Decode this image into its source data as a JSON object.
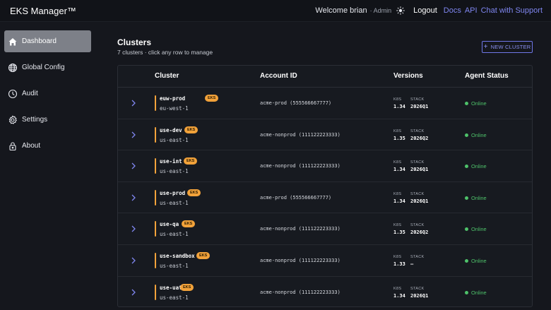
{
  "header": {
    "brand": "EKS Manager™",
    "welcome": "Welcome brian",
    "role": "· Admin",
    "logout": "Logout",
    "links": [
      "Docs",
      "API",
      "Chat with Support"
    ]
  },
  "sidebar": {
    "items": [
      {
        "label": "Dashboard",
        "icon": "home-icon",
        "active": true
      },
      {
        "label": "Global Config",
        "icon": "globe-icon",
        "active": false
      },
      {
        "label": "Audit",
        "icon": "clock-icon",
        "active": false
      },
      {
        "label": "Settings",
        "icon": "gear-icon",
        "active": false
      },
      {
        "label": "About",
        "icon": "lock-icon",
        "active": false
      }
    ]
  },
  "main": {
    "title": "Clusters",
    "subtitle": "7 clusters · click any row to manage",
    "new_button": "NEW CLUSTER"
  },
  "table": {
    "columns": [
      "Cluster",
      "Account ID",
      "Versions",
      "Agent Status"
    ],
    "version_labels": {
      "k8s": "K8S",
      "stack": "STACK"
    },
    "rows": [
      {
        "name": "euw-prod",
        "badge": "EKS",
        "region": "eu-west-1",
        "account": "acme-prod (555566667777)",
        "k8s": "1.34",
        "stack": "2026Q1",
        "status": "Online"
      },
      {
        "name": "use-dev",
        "badge": "EKS",
        "region": "us-east-1",
        "account": "acme-nonprod (111122223333)",
        "k8s": "1.35",
        "stack": "2026Q2",
        "status": "Online"
      },
      {
        "name": "use-int",
        "badge": "EKS",
        "region": "us-east-1",
        "account": "acme-nonprod (111122223333)",
        "k8s": "1.34",
        "stack": "2026Q1",
        "status": "Online"
      },
      {
        "name": "use-prod",
        "badge": "EKS",
        "region": "us-east-1",
        "account": "acme-prod (555566667777)",
        "k8s": "1.34",
        "stack": "2026Q1",
        "status": "Online"
      },
      {
        "name": "use-qa",
        "badge": "EKS",
        "region": "us-east-1",
        "account": "acme-nonprod (111122223333)",
        "k8s": "1.35",
        "stack": "2026Q2",
        "status": "Online"
      },
      {
        "name": "use-sandbox",
        "badge": "EKS",
        "region": "us-east-1",
        "account": "acme-nonprod (111122223333)",
        "k8s": "1.33",
        "stack": "—",
        "status": "Online"
      },
      {
        "name": "use-uat",
        "badge": "EKS",
        "region": "us-east-1",
        "account": "acme-nonprod (111122223333)",
        "k8s": "1.34",
        "stack": "2026Q1",
        "status": "Online"
      }
    ]
  },
  "colors": {
    "accent": "#7f86f0",
    "badge": "#f2a23a",
    "online": "#4ec26a",
    "active_nav": "#7d8088"
  }
}
